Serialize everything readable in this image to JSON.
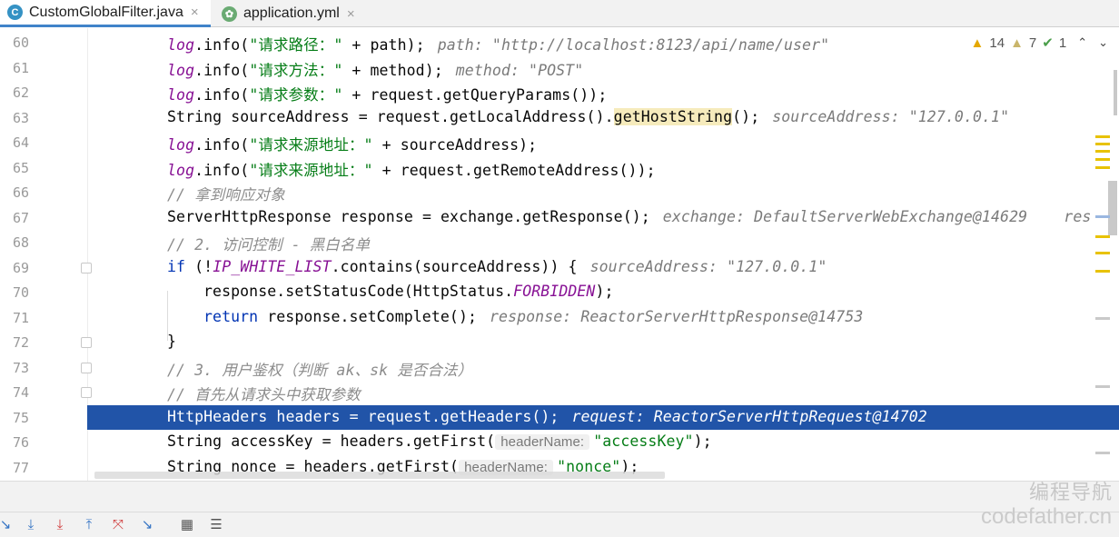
{
  "tabs": [
    {
      "icon": "java-class-icon",
      "glyph": "C",
      "label": "CustomGlobalFilter.java",
      "close": "×"
    },
    {
      "icon": "yaml-file-icon",
      "glyph": "✿",
      "label": "application.yml",
      "close": "×"
    }
  ],
  "inspections": {
    "warnings": "14",
    "weak_warnings": "7",
    "typos": "1",
    "up": "⌃",
    "down": "⌄"
  },
  "lines": [
    {
      "n": "60",
      "code": "log.info(\"请求路径：\" + path);",
      "hint": "path: \"http://localhost:8123/api/name/user\""
    },
    {
      "n": "61",
      "code": "log.info(\"请求方法：\" + method);",
      "hint": "method: \"POST\""
    },
    {
      "n": "62",
      "code": "log.info(\"请求参数：\" + request.getQueryParams());"
    },
    {
      "n": "63",
      "code": "String sourceAddress = request.getLocalAddress().getHostString();",
      "hint": "sourceAddress: \"127.0.0.1\""
    },
    {
      "n": "64",
      "code": "log.info(\"请求来源地址：\" + sourceAddress);"
    },
    {
      "n": "65",
      "code": "log.info(\"请求来源地址：\" + request.getRemoteAddress());"
    },
    {
      "n": "66",
      "code": "// 拿到响应对象"
    },
    {
      "n": "67",
      "code": "ServerHttpResponse response = exchange.getResponse();",
      "hint": "exchange: DefaultServerWebExchange@14629    res"
    },
    {
      "n": "68",
      "code": "// 2. 访问控制 - 黑白名单"
    },
    {
      "n": "69",
      "code": "if (!IP_WHITE_LIST.contains(sourceAddress)) {",
      "hint": "sourceAddress: \"127.0.0.1\""
    },
    {
      "n": "70",
      "code": "response.setStatusCode(HttpStatus.FORBIDDEN);"
    },
    {
      "n": "71",
      "code": "return response.setComplete();",
      "hint": "response: ReactorServerHttpResponse@14753"
    },
    {
      "n": "72",
      "code": "}"
    },
    {
      "n": "73",
      "code": "// 3. 用户鉴权（判断 ak、sk 是否合法）"
    },
    {
      "n": "74",
      "code": "// 首先从请求头中获取参数"
    },
    {
      "n": "75",
      "code": "HttpHeaders headers = request.getHeaders();",
      "hint": "request: ReactorServerHttpRequest@14702"
    },
    {
      "n": "76",
      "code": "String accessKey = headers.getFirst(headerName: \"accessKey\");",
      "param_hint": "headerName:"
    },
    {
      "n": "77",
      "code": "String nonce = headers.getFirst(headerName: \"nonce\");",
      "param_hint": "headerName:"
    }
  ],
  "bottom_toolbar": [
    {
      "icon": "step-over-icon",
      "glyph": "↘"
    },
    {
      "icon": "step-into-icon",
      "glyph": "⤓"
    },
    {
      "icon": "force-step-into-icon",
      "glyph": "⤓"
    },
    {
      "icon": "step-out-icon",
      "glyph": "⤒"
    },
    {
      "icon": "drop-frame-icon",
      "glyph": "⤧"
    },
    {
      "icon": "run-to-cursor-icon",
      "glyph": "↘"
    },
    {
      "icon": "evaluate-expression-icon",
      "glyph": "▦"
    },
    {
      "icon": "trace-current-stream-icon",
      "glyph": "☰"
    }
  ],
  "watermark": {
    "line1": "编程导航",
    "line2": "codefather.cn"
  },
  "colors": {
    "current_line": "#2154a8",
    "keyword": "#0033b3",
    "string": "#067d17",
    "static_field": "#871094",
    "comment": "#8c8c8c",
    "tab_underline": "#4083c9"
  }
}
